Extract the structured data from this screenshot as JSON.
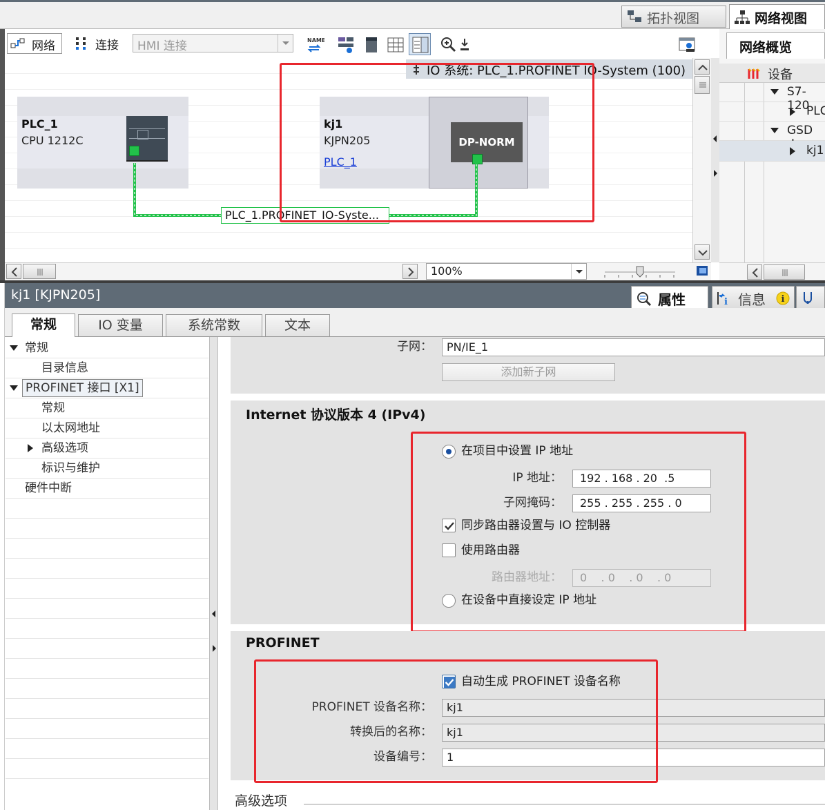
{
  "top_tabs": {
    "topology": "拓扑视图",
    "network": "网络视图"
  },
  "toolbar": {
    "network": "网络",
    "connect": "连接",
    "hmi_select": "HMI 连接"
  },
  "overview": {
    "title": "网络概览",
    "device_col": "设备",
    "rows": [
      "S7-120",
      "PLC",
      "GSD de",
      "kj1"
    ]
  },
  "canvas": {
    "io_system": "IO 系统: PLC_1.PROFINET IO-System (100)",
    "plc_name": "PLC_1",
    "plc_type": "CPU 1212C",
    "dev_name": "kj1",
    "dev_type": "KJPN205",
    "dev_link": "PLC_1",
    "dev_module": "DP-NORM",
    "net_label": "PLC_1.PROFINET_IO-Syste..."
  },
  "zoom": "100%",
  "props": {
    "title": "kj1 [KJPN205]",
    "tab_properties": "属性",
    "tab_info": "信息",
    "tabs": [
      "常规",
      "IO 变量",
      "系统常数",
      "文本"
    ],
    "tree": [
      "常规",
      "目录信息",
      "PROFINET 接口 [X1]",
      "常规",
      "以太网地址",
      "高级选项",
      "标识与维护",
      "硬件中断"
    ]
  },
  "form": {
    "subnet_label": "子网：",
    "subnet_value": "PN/IE_1",
    "add_subnet": "添加新子网",
    "ipv4_header": "Internet 协议版本 4 (IPv4)",
    "opt_project_ip": "在项目中设置 IP 地址",
    "ip_label": "IP 地址：",
    "ip_value": [
      "192",
      "168",
      "20",
      "5"
    ],
    "mask_label": "子网掩码：",
    "mask_value": [
      "255",
      "255",
      "255",
      "0"
    ],
    "sync_router": "同步路由器设置与 IO 控制器",
    "use_router": "使用路由器",
    "router_label": "路由器地址：",
    "router_value": [
      "0",
      "0",
      "0",
      "0"
    ],
    "opt_device_ip": "在设备中直接设定 IP 地址",
    "profinet_header": "PROFINET",
    "auto_name": "自动生成 PROFINET 设备名称",
    "pn_name_label": "PROFINET 设备名称：",
    "pn_name_value": "kj1",
    "conv_name_label": "转换后的名称：",
    "conv_name_value": "kj1",
    "dev_num_label": "设备编号：",
    "dev_num_value": "1",
    "advanced": "高级选项"
  },
  "colors": {
    "accent_red": "#e8262d",
    "link_blue": "#1a3fd6",
    "green": "#22c24a"
  }
}
